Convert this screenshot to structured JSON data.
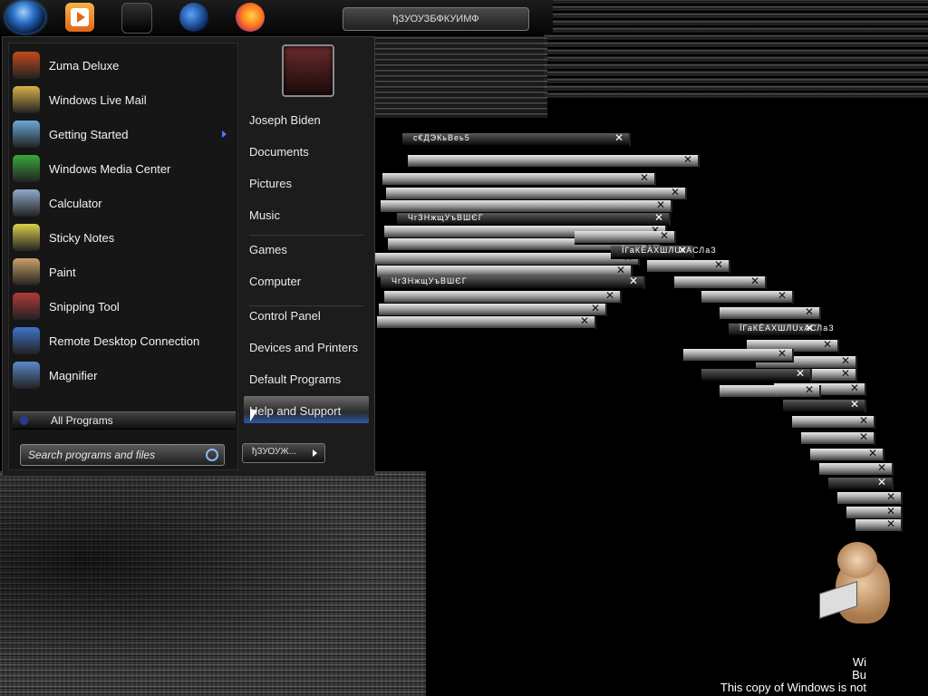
{
  "taskbar": {
    "window_button_label": "ђЗУОУЗБФКУИМФ"
  },
  "start_menu": {
    "programs": [
      {
        "label": "Zuma Deluxe",
        "icon": "zuma-icon",
        "color": "#c44a1a"
      },
      {
        "label": "Windows Live Mail",
        "icon": "mail-icon",
        "color": "#d6b24a"
      },
      {
        "label": "Getting Started",
        "icon": "getting-started-icon",
        "color": "#6aa8d8",
        "has_submenu": true
      },
      {
        "label": "Windows Media Center",
        "icon": "media-center-icon",
        "color": "#3aa83a"
      },
      {
        "label": "Calculator",
        "icon": "calculator-icon",
        "color": "#8fa9c9"
      },
      {
        "label": "Sticky Notes",
        "icon": "sticky-notes-icon",
        "color": "#d9cf4a"
      },
      {
        "label": "Paint",
        "icon": "paint-icon",
        "color": "#c9a06a"
      },
      {
        "label": "Snipping Tool",
        "icon": "snipping-tool-icon",
        "color": "#b13a3a"
      },
      {
        "label": "Remote Desktop Connection",
        "icon": "remote-desktop-icon",
        "color": "#3f74c9"
      },
      {
        "label": "Magnifier",
        "icon": "magnifier-icon",
        "color": "#5a88c9"
      }
    ],
    "all_programs_label": "All Programs",
    "search_placeholder": "Search programs and files",
    "right_items": [
      {
        "label": "Joseph Biden"
      },
      {
        "label": "Documents"
      },
      {
        "label": "Pictures"
      },
      {
        "label": "Music"
      },
      {
        "label": "Games"
      },
      {
        "label": "Computer"
      },
      {
        "label": "Control Panel"
      },
      {
        "label": "Devices and Printers"
      },
      {
        "label": "Default Programs"
      },
      {
        "label": "Help and Support"
      }
    ],
    "shutdown_label": "ђЗУОУЖ..."
  },
  "glitch_windows": {
    "titles": [
      "с€ДЭКьВеь5",
      "ЧгЗНжщУъВШЄГ",
      "ЧгЗНжщУъВШЄГ",
      "ЇГаКЁАХШЛUхАСЛаЗ",
      "ЇГаКЁАХШЛUхАСЛаЗ"
    ]
  },
  "watermark": {
    "line1": "Wi",
    "line2": "Bu",
    "line3": "This copy of Windows is not"
  }
}
